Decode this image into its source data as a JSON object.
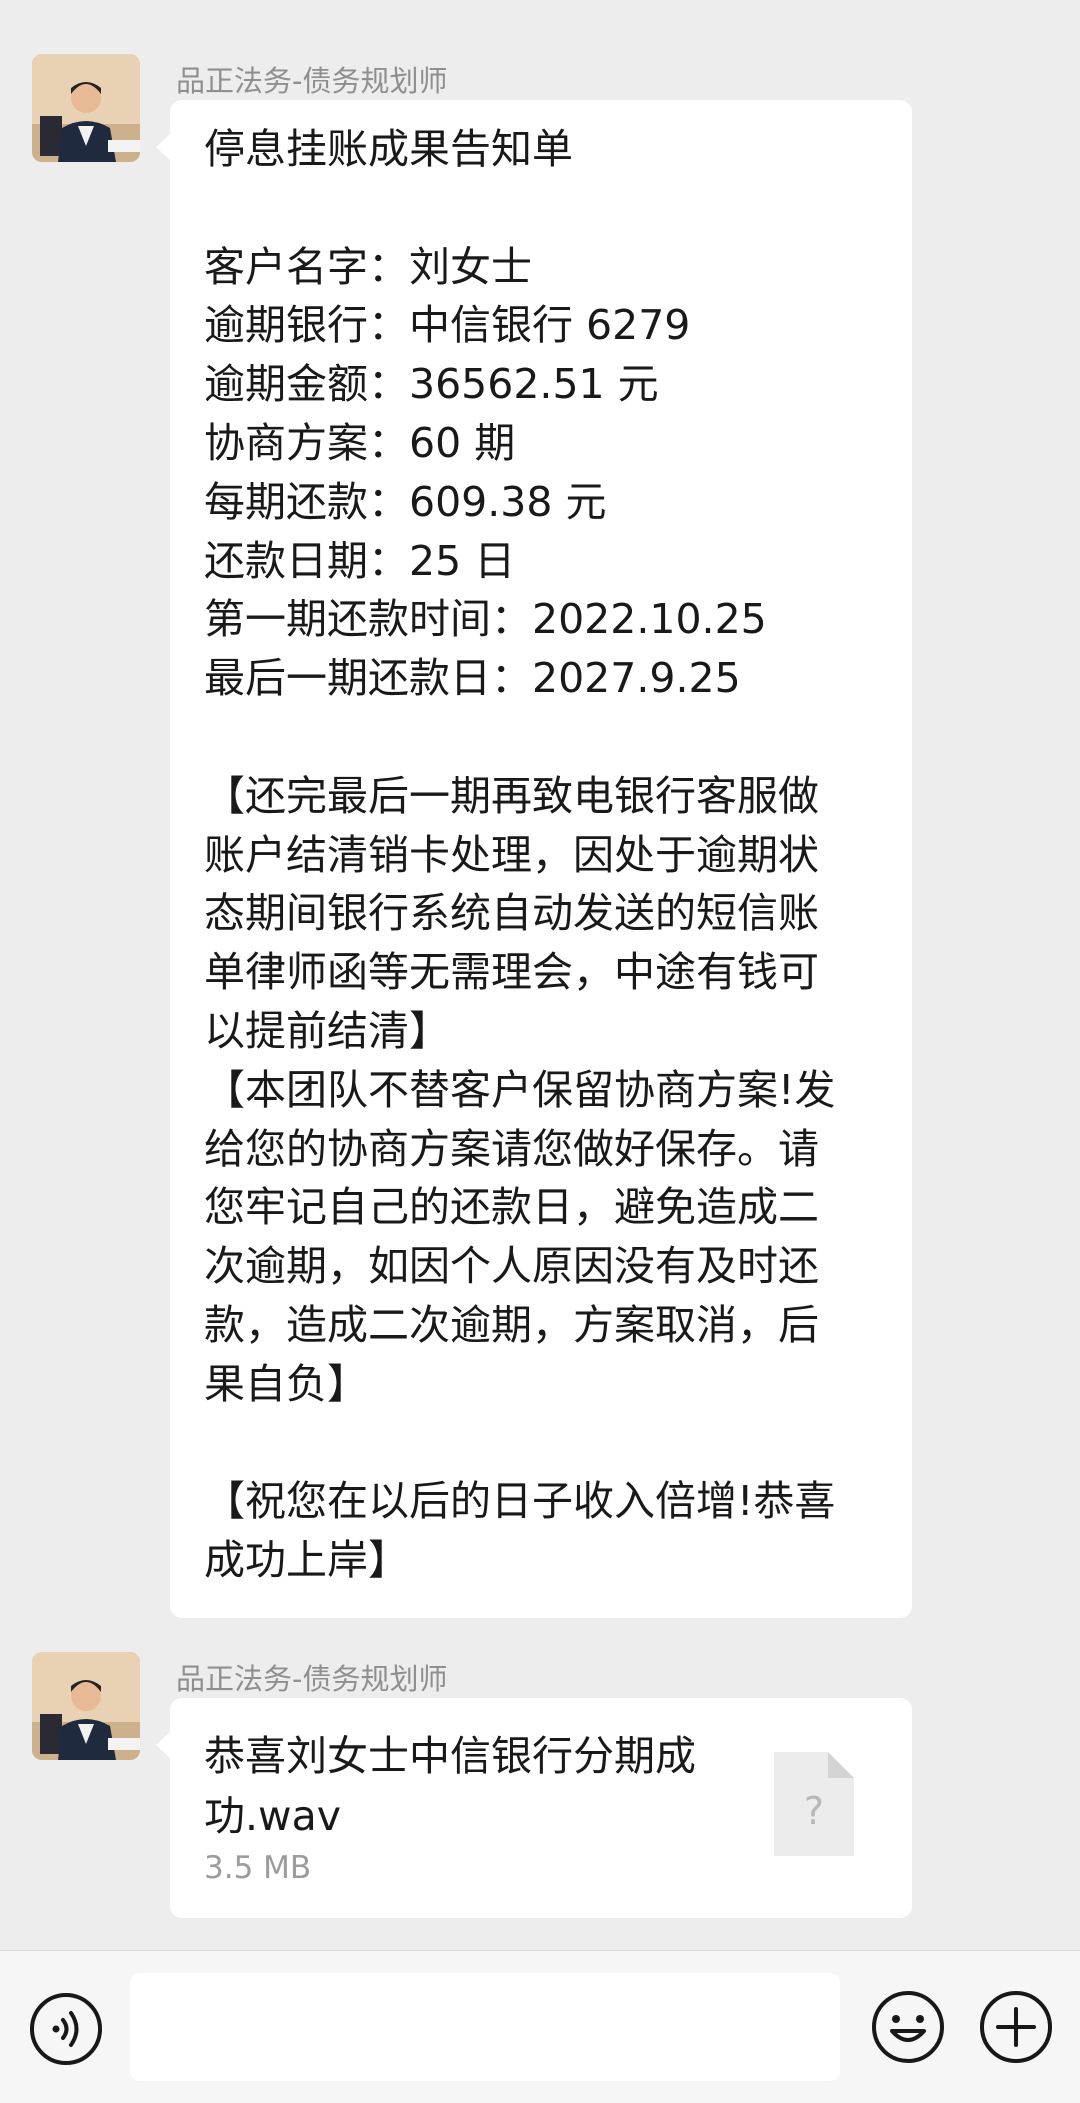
{
  "messages": [
    {
      "sender": "品正法务-债务规划师",
      "lines": [
        "停息挂账成果告知单",
        "",
        "客户名字：刘女士",
        "逾期银行：中信银行 6279",
        "逾期金额：36562.51 元",
        "协商方案：60 期",
        "每期还款：609.38 元",
        "还款日期：25 日",
        "第一期还款时间：2022.10.25",
        "最后一期还款日：2027.9.25",
        "",
        "【还完最后一期再致电银行客服做",
        "账户结清销卡处理，因处于逾期状",
        "态期间银行系统自动发送的短信账",
        "单律师函等无需理会，中途有钱可",
        "以提前结清】",
        "【本团队不替客户保留协商方案!发",
        "给您的协商方案请您做好保存。请",
        "您牢记自己的还款日，避免造成二",
        "次逾期，如因个人原因没有及时还",
        "款，造成二次逾期，方案取消，后",
        "果自负】",
        "",
        "【祝您在以后的日子收入倍增!恭喜",
        "成功上岸】"
      ]
    },
    {
      "sender": "品正法务-债务规划师",
      "file": {
        "name": "恭喜刘女士中信银行分期成功.wav",
        "size": "3.5 MB",
        "icon": "unknown-file-icon",
        "icon_glyph": "?"
      }
    }
  ],
  "input_bar": {
    "voice_icon": "voice-icon",
    "emoji_icon": "emoji-icon",
    "plus_icon": "plus-icon"
  }
}
